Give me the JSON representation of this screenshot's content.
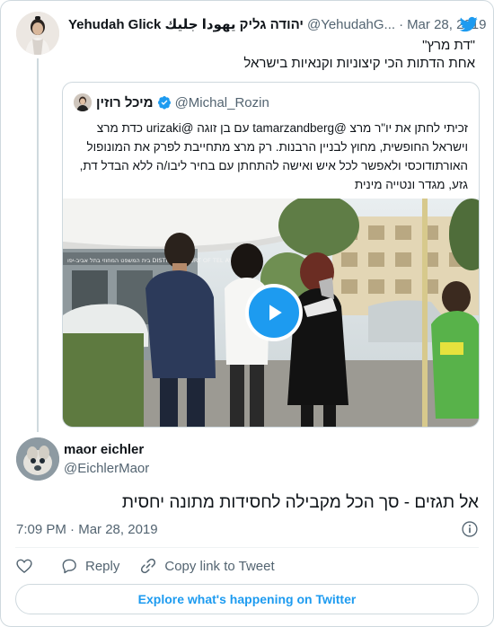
{
  "parent_tweet": {
    "author_name": "Yehudah Glick יהודה גליק يهودا جليك",
    "handle": "@YehudahG...",
    "separator": "·",
    "date": "Mar 28, 2019",
    "text_line1": "\"דת מרץ\"",
    "text_line2": "אחת הדתות הכי קיצוניות וקנאיות בישראל",
    "avatar_icon": "profile-photo",
    "brand_icon": "twitter-bird-icon"
  },
  "quoted_tweet": {
    "author_name": "מיכל רוזין",
    "verified_icon": "verified-badge-icon",
    "handle": "@Michal_Rozin",
    "text": "זכיתי לחתן את יו\"ר מרצ @tamarzandberg עם בן זוגה @urizaki כדת מרצ וישראל החופשית, מחוץ לבניין הרבנות. רק מרצ מתחייבת לפרק את המונופול האורתודוכסי ולאפשר לכל איש ואישה להתחתן עם בחיר ליבו/ה ללא הבדל דת, גזע, מגדר ונטייה מינית",
    "media": {
      "type": "video",
      "play_icon": "play-button-icon",
      "sign_text": "בית המשפט המחוזי בתל אביב-יפו DISTRICT COURT OF TEL AVIV"
    }
  },
  "main_tweet": {
    "author_name": "maor eichler",
    "handle": "@EichlerMaor",
    "text": "אל תגזים - סך הכל מקבילה לחסידות מתונה יחסית",
    "time": "7:09 PM",
    "separator": "·",
    "date": "Mar 28, 2019",
    "info_icon": "info-icon"
  },
  "actions": {
    "like_icon": "heart-icon",
    "reply_label": "Reply",
    "reply_icon": "reply-icon",
    "copy_label": "Copy link to Tweet",
    "copy_icon": "link-icon"
  },
  "explore_label": "Explore what's happening on Twitter",
  "colors": {
    "accent": "#1d9bf0",
    "text": "#0f1419",
    "secondary": "#536471",
    "border": "#cfd9de"
  }
}
